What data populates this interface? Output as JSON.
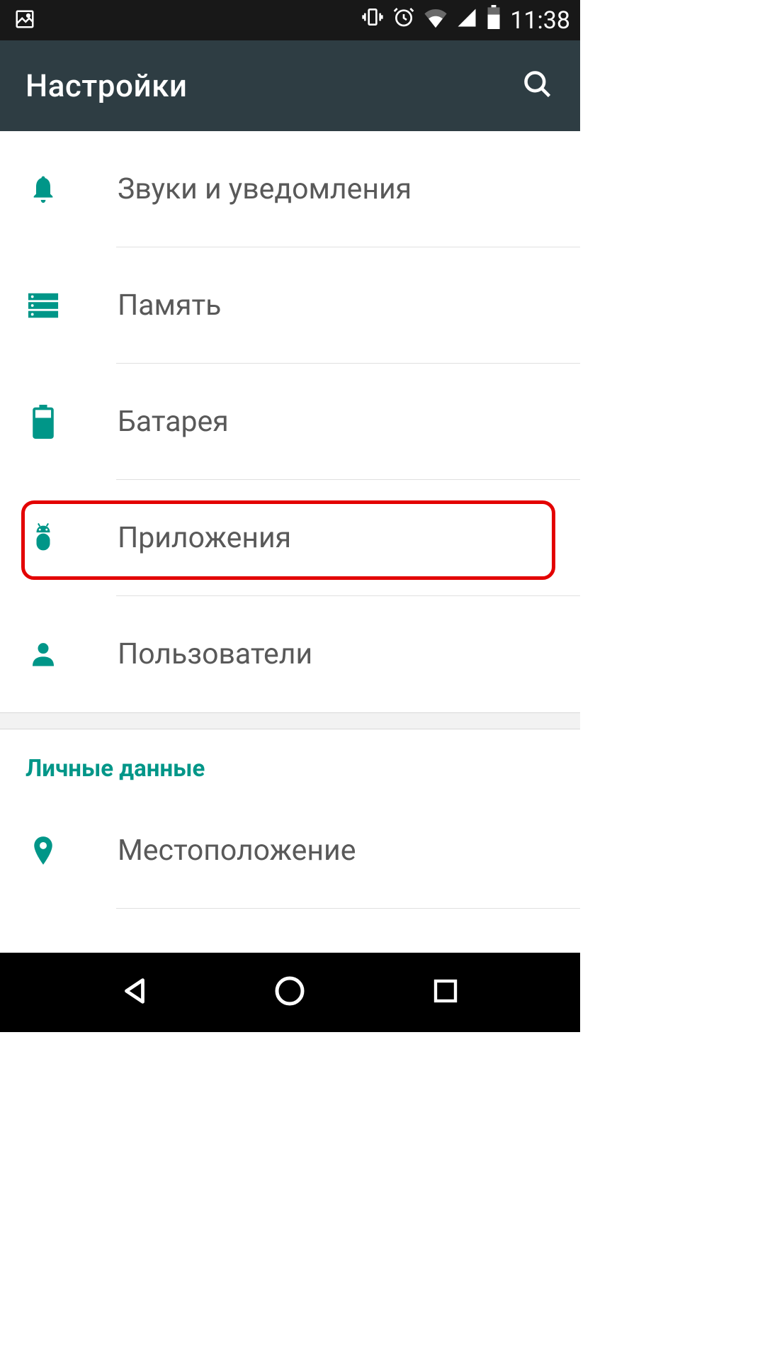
{
  "status": {
    "time": "11:38"
  },
  "header": {
    "title": "Настройки"
  },
  "items": [
    {
      "label": "Звуки и уведомления",
      "icon": "bell"
    },
    {
      "label": "Память",
      "icon": "storage"
    },
    {
      "label": "Батарея",
      "icon": "battery"
    },
    {
      "label": "Приложения",
      "icon": "android",
      "highlighted": true
    },
    {
      "label": "Пользователи",
      "icon": "user"
    }
  ],
  "section": {
    "header": "Личные данные"
  },
  "section_items": [
    {
      "label": "Местоположение",
      "icon": "location"
    }
  ]
}
